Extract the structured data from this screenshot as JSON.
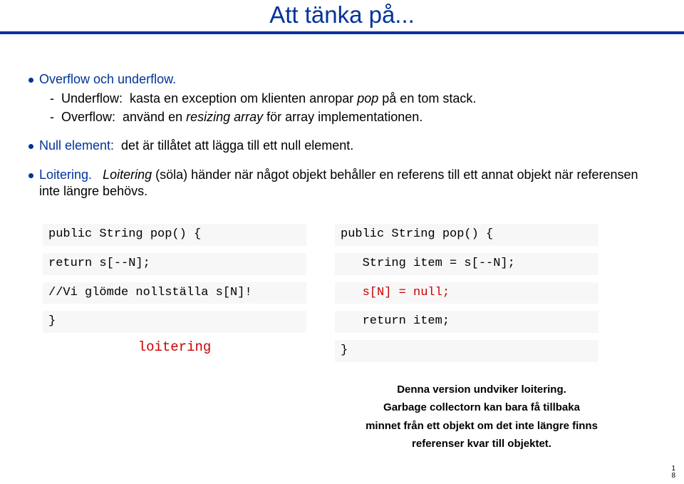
{
  "title": "Att tänka på...",
  "bullet1": {
    "lead": "Overflow och underflow.",
    "sub1_pre": "-  Underflow:  kasta en exception om klienten anropar ",
    "sub1_it": "pop",
    "sub1_post": " på en tom stack.",
    "sub2_pre": "-  Overflow:  använd en ",
    "sub2_it": "resizing array",
    "sub2_post": " för array implementationen."
  },
  "bullet2": {
    "lead": "Null element:",
    "rest": "  det är tillåtet att lägga till ett null element."
  },
  "bullet3": {
    "lead": "Loitering.",
    "it1": "Loitering",
    "mid": " (söla) händer när något objekt behåller en referens till ett annat objekt när referensen inte längre behövs."
  },
  "code_left": {
    "l1": "public String pop() {",
    "l2": "return s[--N];",
    "l3": "//Vi glömde nollställa s[N]!",
    "l4": "}",
    "label": "loitering"
  },
  "code_right": {
    "l1": "public String pop() {",
    "l2": "   String item = s[--N];",
    "l3a": "   ",
    "l3b": "s[N] = null;",
    "l4": "   return item;",
    "l5": "}",
    "note1": "Denna version undviker loitering.",
    "note2": "Garbage collectorn kan bara få tillbaka",
    "note3": "minnet från ett objekt om det inte längre finns",
    "note4": "referenser kvar till objektet."
  },
  "page": {
    "a": "1",
    "b": "8"
  }
}
